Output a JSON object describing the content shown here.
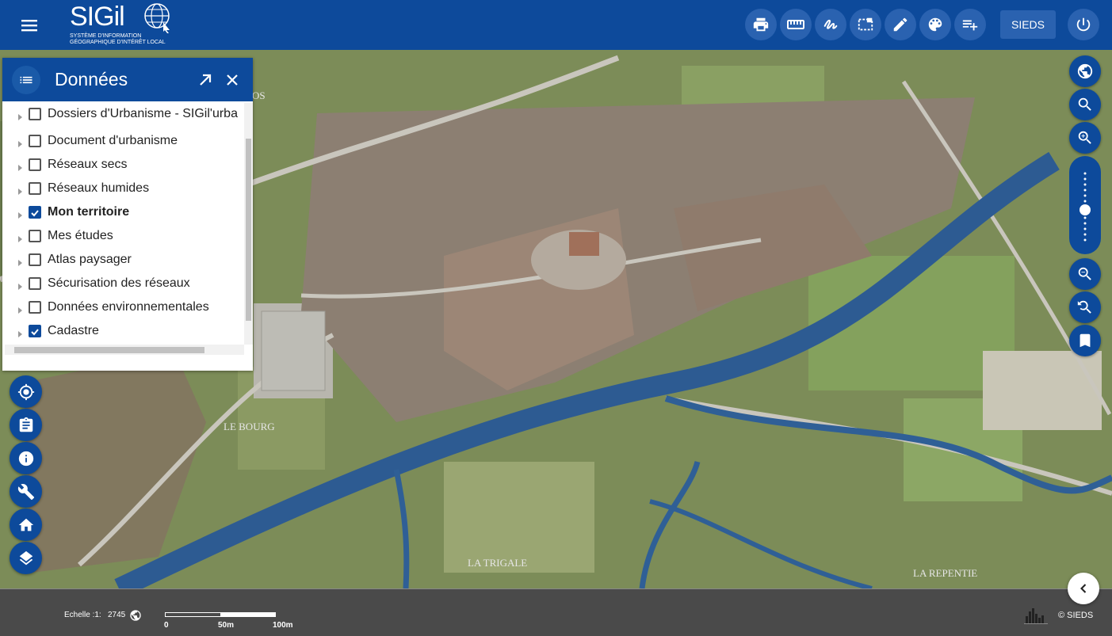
{
  "header": {
    "logo_text": "SIGil",
    "logo_sub_line1": "SYSTÈME D'INFORMATION",
    "logo_sub_line2": "GÉOGRAPHIQUE D'INTÉRÊT LOCAL",
    "user_button": "SIEDS",
    "tools": [
      "print-icon",
      "ruler-icon",
      "draw-icon",
      "select-area-icon",
      "pencil-icon",
      "palette-icon",
      "add-layer-icon"
    ]
  },
  "panel": {
    "title": "Données",
    "items": [
      {
        "label": "Dossiers d'Urbanisme - SIGil'urba",
        "checked": false,
        "bold": false
      },
      {
        "label": "Document d'urbanisme",
        "checked": false,
        "bold": false
      },
      {
        "label": "Réseaux secs",
        "checked": false,
        "bold": false
      },
      {
        "label": "Réseaux humides",
        "checked": false,
        "bold": false
      },
      {
        "label": "Mon territoire",
        "checked": true,
        "bold": true
      },
      {
        "label": "Mes études",
        "checked": false,
        "bold": false
      },
      {
        "label": "Atlas paysager",
        "checked": false,
        "bold": false
      },
      {
        "label": "Sécurisation des réseaux",
        "checked": false,
        "bold": false
      },
      {
        "label": "Données environnementales",
        "checked": false,
        "bold": false
      },
      {
        "label": "Cadastre",
        "checked": true,
        "bold": false
      }
    ]
  },
  "map": {
    "place_labels": [
      "LA TRIGALE",
      "LA REPENTIE",
      "LE BOURG",
      "OS"
    ]
  },
  "footer": {
    "scale_label": "Echelle :1:",
    "scale_value": "2745",
    "scale_ticks": [
      "0",
      "50m",
      "100m"
    ],
    "copyright": "© SIEDS"
  },
  "colors": {
    "primary": "#0d4a9b",
    "footer": "#4a4a4a"
  }
}
